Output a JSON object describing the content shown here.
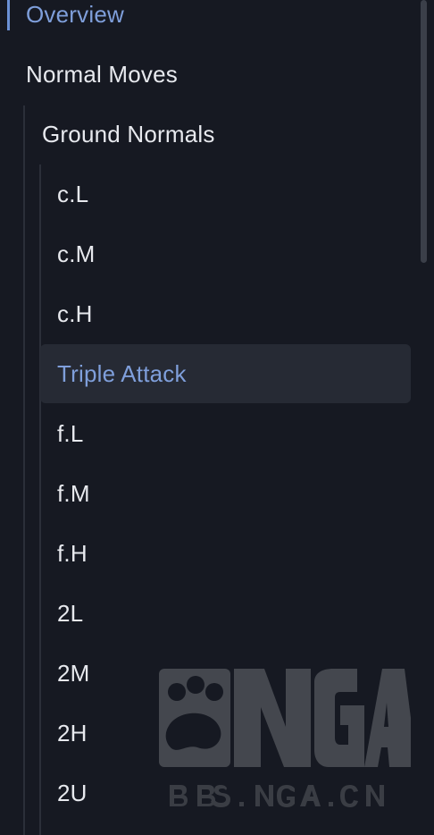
{
  "nav": {
    "overview": "Overview",
    "normal_moves": "Normal Moves",
    "ground_normals": "Ground Normals",
    "items": [
      "c.L",
      "c.M",
      "c.H",
      "Triple Attack",
      "f.L",
      "f.M",
      "f.H",
      "2L",
      "2M",
      "2H",
      "2U"
    ],
    "selected": "Triple Attack"
  },
  "watermark": {
    "logo_text": "NGA",
    "site_text": "BBS.NGA.CN"
  },
  "colors": {
    "background": "#161922",
    "text": "#e7e9ee",
    "accent": "#7f9fdb",
    "selected_background": "#262a34"
  }
}
